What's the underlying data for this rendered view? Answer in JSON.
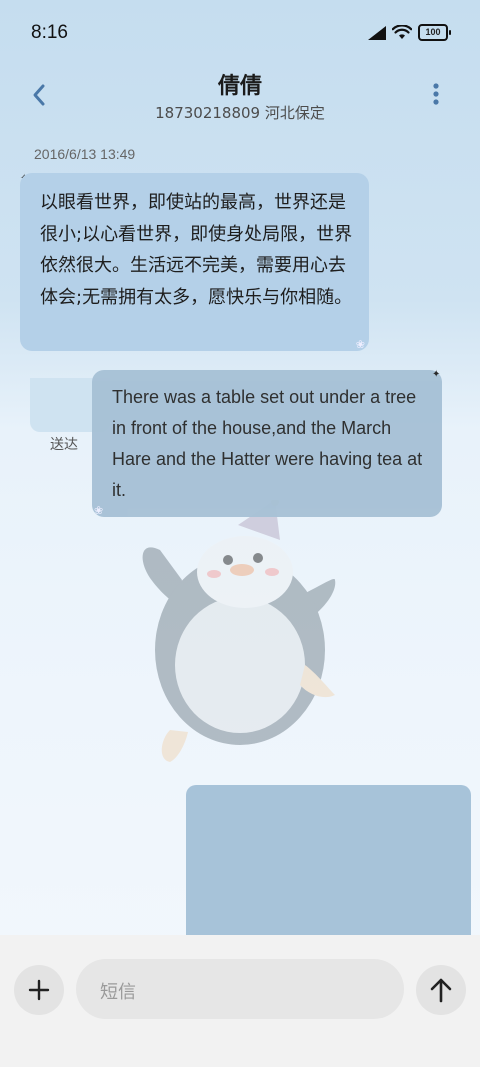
{
  "status_bar": {
    "time": "8:16",
    "battery": "100"
  },
  "header": {
    "contact_name": "倩倩",
    "contact_detail": "18730218809 河北保定"
  },
  "conversation": {
    "timestamp": "2016/6/13 13:49",
    "incoming_message": "以眼看世界，即使站的最高，世界还是很小;以心看世界，即使身处局限，世界依然很大。生活远不完美，需要用心去体会;无需拥有太多，愿快乐与你相随。",
    "outgoing_message": "There was a table set out under a tree in front of the house,and the March Hare and the Hatter were having tea at it.",
    "delivery_status": "送达"
  },
  "composer": {
    "placeholder": "短信"
  },
  "icons": {
    "back": "chevron-left-icon",
    "menu": "more-vertical-icon",
    "add": "plus-icon",
    "send": "arrow-up-icon"
  },
  "colors": {
    "accent": "#4a78a8",
    "bubble_in": "#b4d0e8",
    "bubble_out": "#a7c1d6"
  }
}
